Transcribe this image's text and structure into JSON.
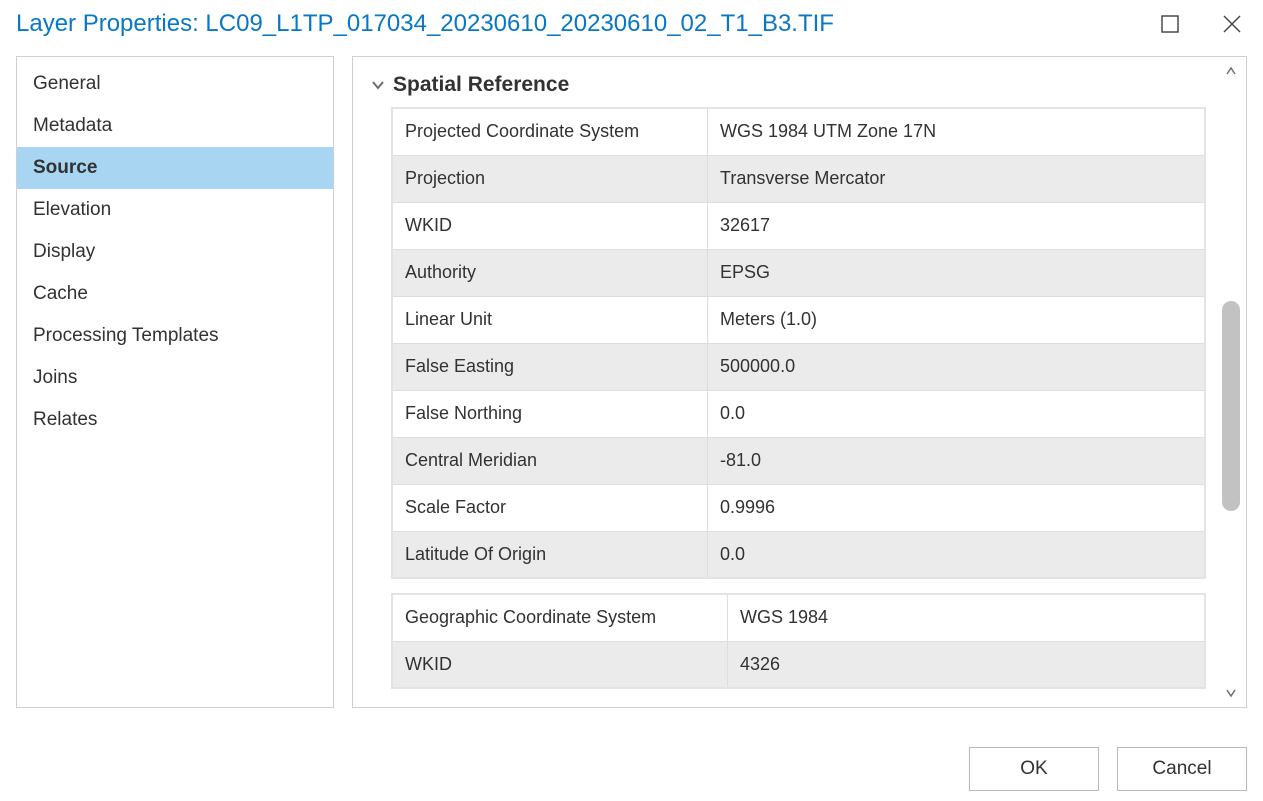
{
  "title": "Layer Properties: LC09_L1TP_017034_20230610_20230610_02_T1_B3.TIF",
  "sidebar": {
    "items": [
      {
        "label": "General"
      },
      {
        "label": "Metadata"
      },
      {
        "label": "Source"
      },
      {
        "label": "Elevation"
      },
      {
        "label": "Display"
      },
      {
        "label": "Cache"
      },
      {
        "label": "Processing Templates"
      },
      {
        "label": "Joins"
      },
      {
        "label": "Relates"
      }
    ],
    "selected": "Source"
  },
  "section": {
    "title": "Spatial Reference"
  },
  "spatial_ref_table1": [
    {
      "key": "Projected Coordinate System",
      "value": "WGS 1984 UTM Zone 17N"
    },
    {
      "key": "Projection",
      "value": "Transverse Mercator"
    },
    {
      "key": "WKID",
      "value": "32617"
    },
    {
      "key": "Authority",
      "value": "EPSG"
    },
    {
      "key": "Linear Unit",
      "value": "Meters (1.0)"
    },
    {
      "key": "False Easting",
      "value": "500000.0"
    },
    {
      "key": "False Northing",
      "value": "0.0"
    },
    {
      "key": "Central Meridian",
      "value": "-81.0"
    },
    {
      "key": "Scale Factor",
      "value": "0.9996"
    },
    {
      "key": "Latitude Of Origin",
      "value": "0.0"
    }
  ],
  "spatial_ref_table2": [
    {
      "key": "Geographic Coordinate System",
      "value": "WGS 1984"
    },
    {
      "key": "WKID",
      "value": "4326"
    }
  ],
  "footer": {
    "ok": "OK",
    "cancel": "Cancel"
  }
}
